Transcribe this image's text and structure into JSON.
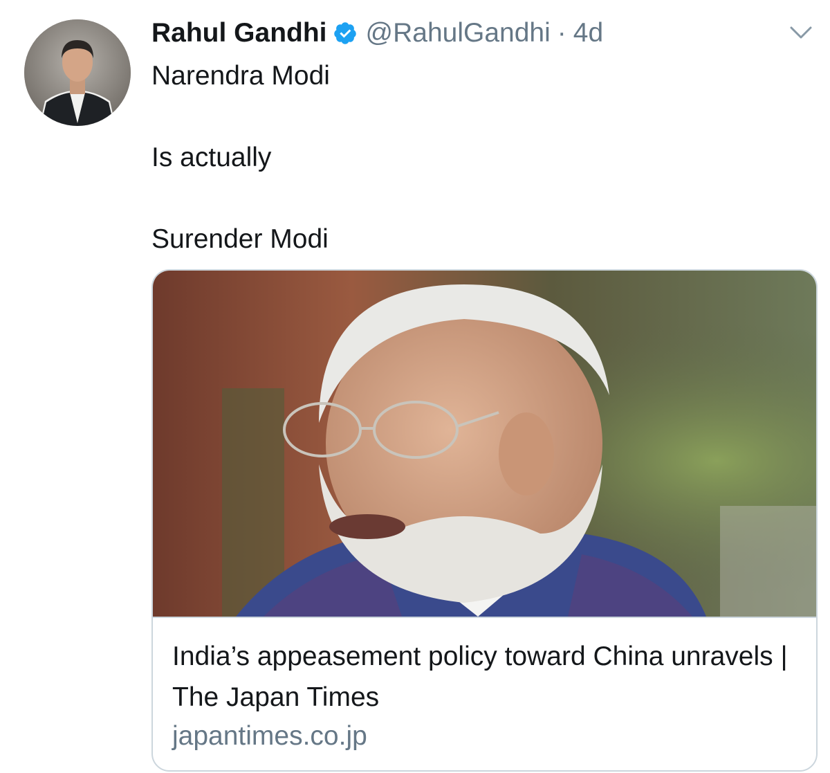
{
  "tweet": {
    "author": {
      "display_name": "Rahul Gandhi",
      "handle": "@RahulGandhi",
      "verified": true,
      "avatar_icon": "profile-photo"
    },
    "separator": "·",
    "timestamp": "4d",
    "menu_icon": "chevron-down-icon",
    "text_lines": [
      "Narendra Modi",
      "Is actually",
      "Surender Modi"
    ]
  },
  "link_card": {
    "image_icon": "article-photo",
    "title": "India’s appeasement policy toward China unravels | The Japan Times",
    "domain": "japantimes.co.jp"
  },
  "colors": {
    "text_primary": "#14171a",
    "text_secondary": "#657786",
    "verified_blue": "#1da1f2",
    "card_border": "#ccd6dd"
  }
}
